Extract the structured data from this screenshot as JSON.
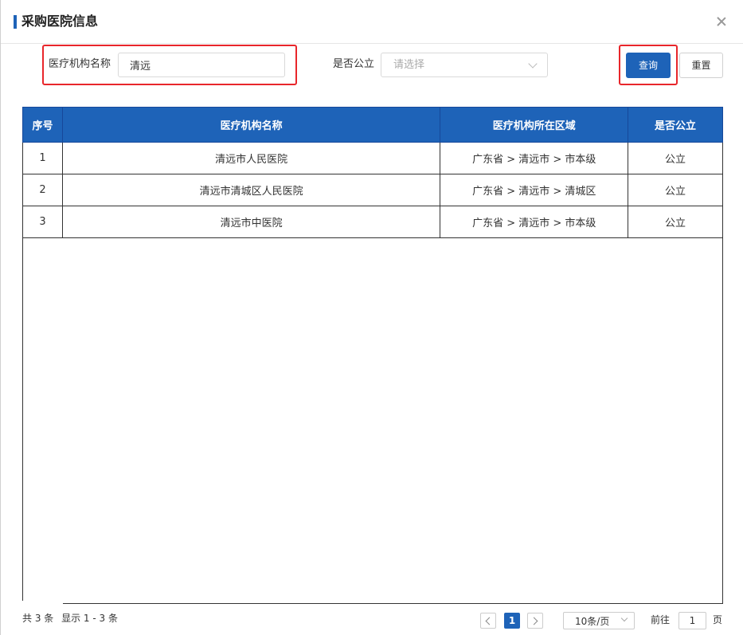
{
  "dialog": {
    "title": "采购医院信息"
  },
  "search": {
    "name_label": "医疗机构名称",
    "name_value": "清远",
    "public_label": "是否公立",
    "public_placeholder": "请选择",
    "query_label": "查询",
    "reset_label": "重置"
  },
  "table": {
    "headers": [
      "序号",
      "医疗机构名称",
      "医疗机构所在区域",
      "是否公立"
    ],
    "rows": [
      [
        "1",
        "清远市人民医院",
        "广东省 > 清远市 > 市本级",
        "公立"
      ],
      [
        "2",
        "清远市清城区人民医院",
        "广东省 > 清远市 > 清城区",
        "公立"
      ],
      [
        "3",
        "清远市中医院",
        "广东省 > 清远市 > 市本级",
        "公立"
      ]
    ]
  },
  "pagination": {
    "total": "共 3 条",
    "range": "显示 1 - 3 条",
    "current_page": "1",
    "page_size": "10条/页",
    "goto_label": "前往",
    "goto_value": "1",
    "goto_suffix": "页"
  },
  "colors": {
    "accent": "#1e63b8",
    "highlight": "#e8262b"
  }
}
